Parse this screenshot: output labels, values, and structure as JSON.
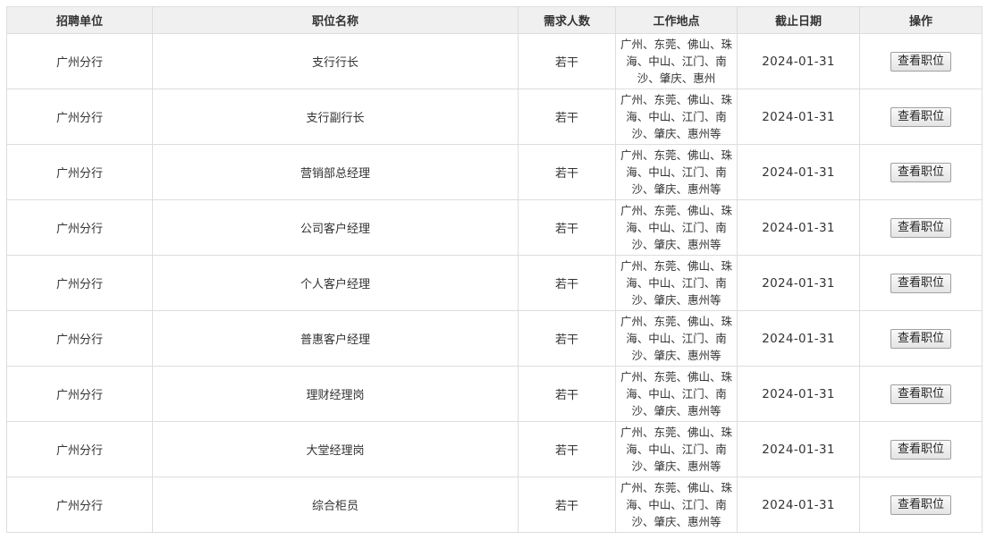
{
  "table": {
    "headers": [
      "招聘单位",
      "职位名称",
      "需求人数",
      "工作地点",
      "截止日期",
      "操作"
    ],
    "rows": [
      {
        "unit": "广州分行",
        "title": "支行行长",
        "count": "若干",
        "location": "广州、东莞、佛山、珠海、中山、江门、南沙、肇庆、惠州",
        "deadline": "2024-01-31",
        "action": "查看职位"
      },
      {
        "unit": "广州分行",
        "title": "支行副行长",
        "count": "若干",
        "location": "广州、东莞、佛山、珠海、中山、江门、南沙、肇庆、惠州等",
        "deadline": "2024-01-31",
        "action": "查看职位"
      },
      {
        "unit": "广州分行",
        "title": "营销部总经理",
        "count": "若干",
        "location": "广州、东莞、佛山、珠海、中山、江门、南沙、肇庆、惠州等",
        "deadline": "2024-01-31",
        "action": "查看职位"
      },
      {
        "unit": "广州分行",
        "title": "公司客户经理",
        "count": "若干",
        "location": "广州、东莞、佛山、珠海、中山、江门、南沙、肇庆、惠州等",
        "deadline": "2024-01-31",
        "action": "查看职位"
      },
      {
        "unit": "广州分行",
        "title": "个人客户经理",
        "count": "若干",
        "location": "广州、东莞、佛山、珠海、中山、江门、南沙、肇庆、惠州等",
        "deadline": "2024-01-31",
        "action": "查看职位"
      },
      {
        "unit": "广州分行",
        "title": "普惠客户经理",
        "count": "若干",
        "location": "广州、东莞、佛山、珠海、中山、江门、南沙、肇庆、惠州等",
        "deadline": "2024-01-31",
        "action": "查看职位"
      },
      {
        "unit": "广州分行",
        "title": "理财经理岗",
        "count": "若干",
        "location": "广州、东莞、佛山、珠海、中山、江门、南沙、肇庆、惠州等",
        "deadline": "2024-01-31",
        "action": "查看职位"
      },
      {
        "unit": "广州分行",
        "title": "大堂经理岗",
        "count": "若干",
        "location": "广州、东莞、佛山、珠海、中山、江门、南沙、肇庆、惠州等",
        "deadline": "2024-01-31",
        "action": "查看职位"
      },
      {
        "unit": "广州分行",
        "title": "综合柜员",
        "count": "若干",
        "location": "广州、东莞、佛山、珠海、中山、江门、南沙、肇庆、惠州等",
        "deadline": "2024-01-31",
        "action": "查看职位"
      }
    ]
  }
}
